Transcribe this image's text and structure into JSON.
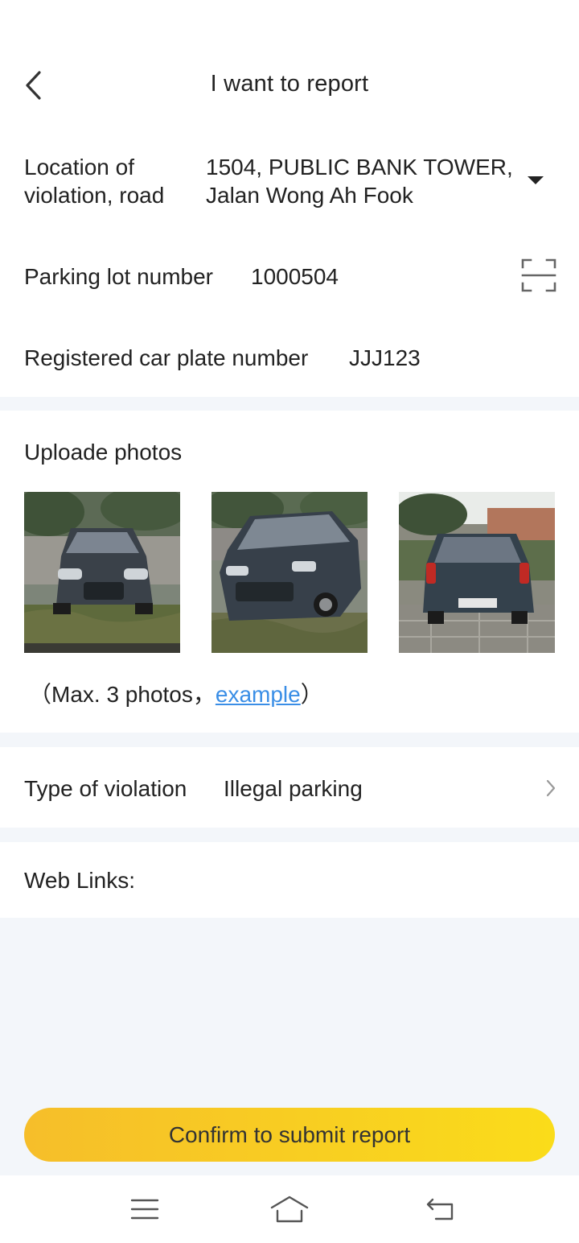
{
  "header": {
    "title": "I want to report",
    "back_icon": "chevron-left-icon"
  },
  "form": {
    "location": {
      "label_line1": "Location of",
      "label_line2": "violation, road",
      "value_line1": "1504, PUBLIC BANK TOWER,",
      "value_line2": "Jalan Wong Ah Fook",
      "icon": "caret-down-icon"
    },
    "parking_lot": {
      "label": "Parking lot number",
      "value": "1000504",
      "icon": "scan-icon"
    },
    "car_plate": {
      "label": "Registered car plate number",
      "value": "JJJ123"
    }
  },
  "photos": {
    "label": "Uploade photos",
    "note_prefix": "（Max. 3 photos，",
    "note_link": "example",
    "note_suffix": "）",
    "link_color": "#3a8ee6"
  },
  "violation": {
    "label": "Type of violation",
    "value": "Illegal parking",
    "icon": "chevron-right-icon"
  },
  "web_links": {
    "label": "Web Links:"
  },
  "submit": {
    "label": "Confirm to submit report",
    "colors": [
      "#f6be2a",
      "#fadc1a"
    ]
  },
  "navbar": {
    "icons": [
      "menu-icon",
      "home-icon",
      "back-icon"
    ]
  }
}
